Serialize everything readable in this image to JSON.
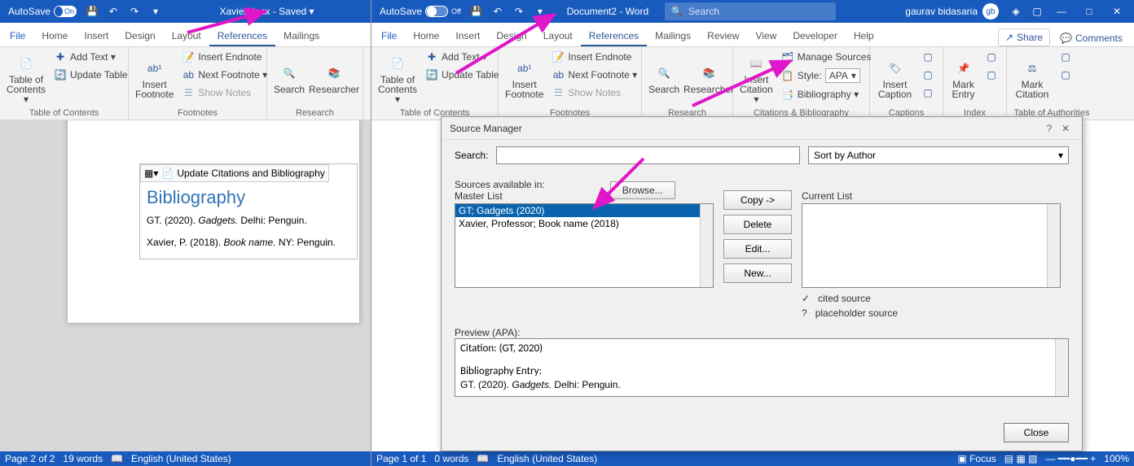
{
  "left": {
    "titlebar": {
      "autosave": "AutoSave",
      "autosave_state": "On",
      "title": "Xavier.docx - Saved ▾"
    },
    "tabs": {
      "file": "File",
      "home": "Home",
      "insert": "Insert",
      "design": "Design",
      "layout": "Layout",
      "references": "References",
      "mailings": "Mailings"
    },
    "ribbon": {
      "toc": {
        "btn": "Table of\nContents ▾",
        "add": "Add Text ▾",
        "upd": "Update Table",
        "grp": "Table of Contents"
      },
      "fn": {
        "btn": "Insert\nFootnote",
        "end": "Insert Endnote",
        "next": "Next Footnote ▾",
        "show": "Show Notes",
        "grp": "Footnotes"
      },
      "res": {
        "search": "Search",
        "researcher": "Researcher",
        "grp": "Research"
      }
    },
    "doc": {
      "toolbar": "Update Citations and Bibliography",
      "title": "Bibliography",
      "e1_a": "GT. (2020). ",
      "e1_b": "Gadgets.",
      "e1_c": " Delhi: Penguin.",
      "e2_a": "Xavier, P. (2018). ",
      "e2_b": "Book name.",
      "e2_c": " NY: Penguin."
    },
    "status": {
      "page": "Page 2 of 2",
      "words": "19 words",
      "lang": "English (United States)"
    }
  },
  "right": {
    "titlebar": {
      "autosave": "AutoSave",
      "autosave_state": "Off",
      "title": "Document2 - Word",
      "search": "Search",
      "user": "gaurav bidasaria"
    },
    "tabs": {
      "file": "File",
      "home": "Home",
      "insert": "Insert",
      "design": "Design",
      "layout": "Layout",
      "references": "References",
      "mailings": "Mailings",
      "review": "Review",
      "view": "View",
      "developer": "Developer",
      "help": "Help",
      "share": "Share",
      "comments": "Comments"
    },
    "ribbon": {
      "toc": {
        "btn": "Table of\nContents ▾",
        "add": "Add Text ▾",
        "upd": "Update Table",
        "grp": "Table of Contents"
      },
      "fn": {
        "btn": "Insert\nFootnote",
        "end": "Insert Endnote",
        "next": "Next Footnote ▾",
        "show": "Show Notes",
        "grp": "Footnotes"
      },
      "res": {
        "search": "Search",
        "researcher": "Researcher",
        "grp": "Research"
      },
      "cit": {
        "btn": "Insert\nCitation ▾",
        "manage": "Manage Sources",
        "style_lbl": "Style:",
        "style_val": "APA",
        "bib": "Bibliography ▾",
        "grp": "Citations & Bibliography"
      },
      "cap": {
        "btn": "Insert\nCaption",
        "grp": "Captions"
      },
      "idx": {
        "btn": "Mark\nEntry",
        "grp": "Index"
      },
      "toa": {
        "btn": "Mark\nCitation",
        "grp": "Table of Authorities"
      }
    },
    "status": {
      "page": "Page 1 of 1",
      "words": "0 words",
      "lang": "English (United States)",
      "focus": "Focus",
      "zoom": "100%"
    }
  },
  "dialog": {
    "title": "Source Manager",
    "search_lbl": "Search:",
    "sort": "Sort by Author",
    "sources_avail": "Sources available in:",
    "master": "Master List",
    "browse": "Browse...",
    "current": "Current List",
    "item1": "GT; Gadgets (2020)",
    "item2": "Xavier, Professor; Book name (2018)",
    "copy": "Copy ->",
    "delete": "Delete",
    "edit": "Edit...",
    "new": "New...",
    "cited": "cited source",
    "placeholder": "placeholder source",
    "preview_lbl": "Preview (APA):",
    "prev1": "Citation:  (GT, 2020)",
    "prev2": "Bibliography Entry:",
    "prev3a": "GT. (2020). ",
    "prev3b": "Gadgets.",
    "prev3c": " Delhi: Penguin.",
    "close": "Close"
  }
}
